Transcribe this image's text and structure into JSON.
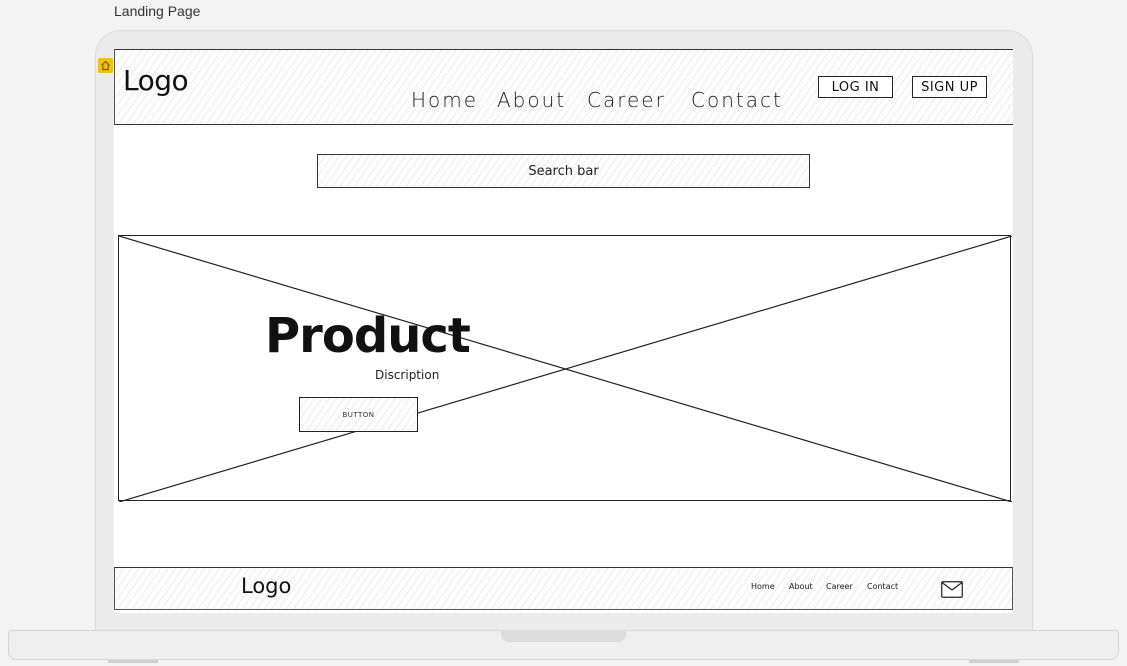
{
  "frame": {
    "title": "Landing Page"
  },
  "header": {
    "logo": "Logo",
    "nav": [
      "Home",
      "About",
      "Career",
      "Contact"
    ],
    "login_label": "LOG IN",
    "signup_label": "SIGN UP"
  },
  "search": {
    "placeholder": "Search bar"
  },
  "hero": {
    "title": "Product",
    "description": "Discription",
    "button_label": "BUTTON"
  },
  "footer": {
    "logo": "Logo",
    "nav": [
      "Home",
      "About",
      "Career",
      "Contact"
    ]
  },
  "icons": {
    "home_badge": "home-icon",
    "mail": "mail-icon"
  },
  "colors": {
    "badge": "#f2c200",
    "line": "#222222"
  }
}
